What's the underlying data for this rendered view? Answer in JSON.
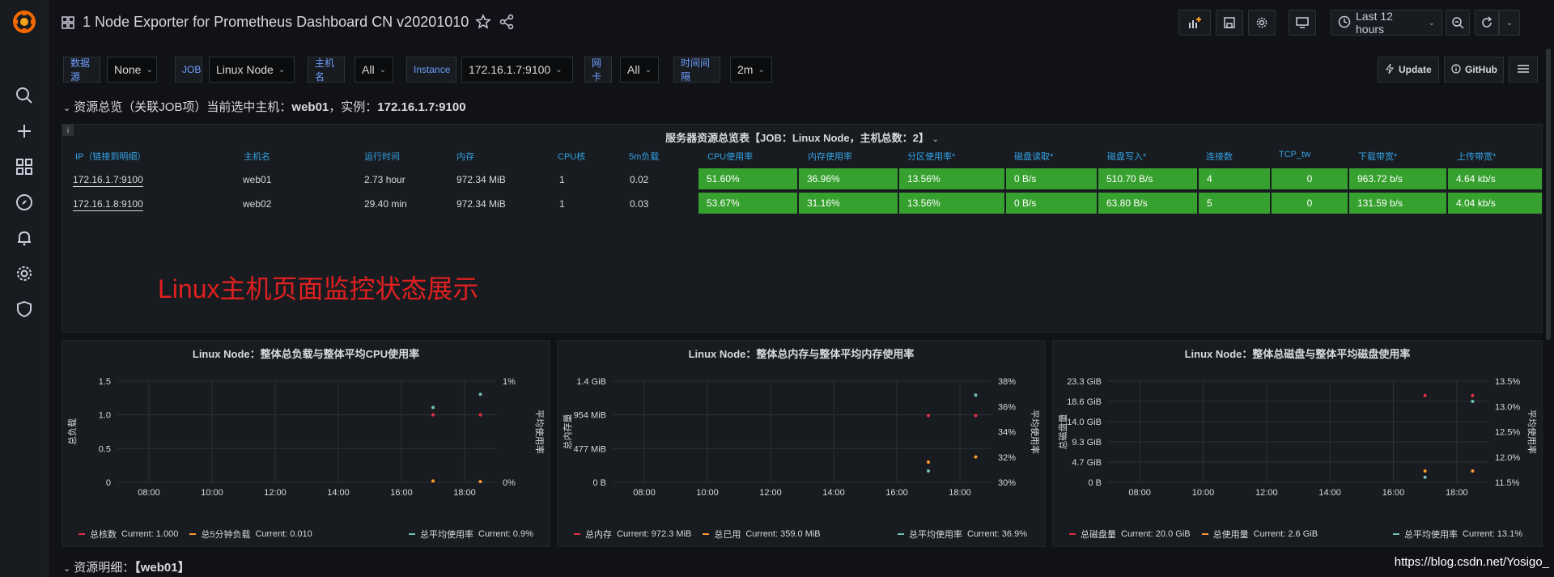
{
  "app": {
    "title": "1 Node Exporter for Prometheus Dashboard CN v20201010",
    "time_range": "Last 12 hours"
  },
  "variables": [
    {
      "label": "数据源",
      "value": "None"
    },
    {
      "label": "JOB",
      "value": "Linux Node"
    },
    {
      "label": "主机名",
      "value": "All"
    },
    {
      "label": "Instance",
      "value": "172.16.1.7:9100"
    },
    {
      "label": "网卡",
      "value": "All"
    },
    {
      "label": "时间间隔",
      "value": "2m"
    }
  ],
  "right_buttons": {
    "update": "Update",
    "github": "GitHub"
  },
  "rows": {
    "overview": {
      "prefix": "资源总览（关联JOB项）当前选中主机：",
      "host": "web01",
      "mid": "，实例：",
      "instance": "172.16.1.7:9100"
    },
    "detail": {
      "prefix": "资源明细：",
      "host": "【web01】"
    }
  },
  "table": {
    "title": "服务器资源总览表【JOB：Linux Node，主机总数：2】",
    "columns": [
      "IP（链接到明细）",
      "主机名",
      "运行时间",
      "内存",
      "CPU核",
      "5m负载",
      "CPU使用率",
      "内存使用率",
      "分区使用率*",
      "磁盘读取*",
      "磁盘写入*",
      "连接数",
      "TCP_tw",
      "下载带宽*",
      "上传带宽*"
    ],
    "rows": [
      [
        "172.16.1.7:9100",
        "web01",
        "2.73 hour",
        "972.34 MiB",
        "1",
        "0.02",
        "51.60%",
        "36.96%",
        "13.56%",
        "0 B/s",
        "510.70 B/s",
        "4",
        "0",
        "963.72 b/s",
        "4.64 kb/s"
      ],
      [
        "172.16.1.8:9100",
        "web02",
        "29.40 min",
        "972.34 MiB",
        "1",
        "0.03",
        "53.67%",
        "31.16%",
        "13.56%",
        "0 B/s",
        "63.80 B/s",
        "5",
        "0",
        "131.59 b/s",
        "4.04 kb/s"
      ]
    ],
    "annotation": "Linux主机页面监控状态展示",
    "colors": {
      "ok": "#37a12f",
      "header": "#33a2e5"
    }
  },
  "chart_data": [
    {
      "type": "scatter",
      "title": "Linux Node：整体总负载与整体平均CPU使用率",
      "x_ticks": [
        "08:00",
        "10:00",
        "12:00",
        "14:00",
        "16:00",
        "18:00"
      ],
      "y_left": {
        "label": "总负载",
        "ticks": [
          "0",
          "0.5",
          "1.0",
          "1.5"
        ],
        "range": [
          0,
          1.5
        ]
      },
      "y_right": {
        "label": "平均使用率",
        "ticks": [
          "0%",
          "1%"
        ],
        "range": [
          0,
          1
        ]
      },
      "series": [
        {
          "name": "总核数",
          "color": "#e02f44",
          "axis": "left",
          "points": [
            [
              "17:00",
              1.0
            ],
            [
              "18:30",
              1.0
            ]
          ],
          "legend": "Current: 1.000"
        },
        {
          "name": "总5分钟负载",
          "color": "#ff9830",
          "axis": "left",
          "points": [
            [
              "17:00",
              0.02
            ],
            [
              "18:30",
              0.01
            ]
          ],
          "legend": "Current: 0.010"
        },
        {
          "name": "总平均使用率",
          "color": "#73bfb8",
          "axis": "right",
          "points": [
            [
              "17:00",
              0.74
            ],
            [
              "18:30",
              0.87
            ]
          ],
          "legend": "Current: 0.9%"
        }
      ]
    },
    {
      "type": "scatter",
      "title": "Linux Node：整体总内存与整体平均内存使用率",
      "x_ticks": [
        "08:00",
        "10:00",
        "12:00",
        "14:00",
        "16:00",
        "18:00"
      ],
      "y_left": {
        "label": "总内存量",
        "ticks": [
          "0 B",
          "477 MiB",
          "954 MiB",
          "1.4 GiB"
        ],
        "range": [
          0,
          1431
        ]
      },
      "y_right": {
        "label": "平均使用率",
        "ticks": [
          "30%",
          "32%",
          "34%",
          "36%",
          "38%"
        ],
        "range": [
          30,
          38
        ]
      },
      "series": [
        {
          "name": "总内存",
          "color": "#e02f44",
          "axis": "left",
          "points": [
            [
              "17:00",
              944.7
            ],
            [
              "18:30",
              944.7
            ]
          ],
          "legend": "Current: 972.3 MiB"
        },
        {
          "name": "总已用",
          "color": "#ff9830",
          "axis": "left",
          "points": [
            [
              "17:00",
              286
            ],
            [
              "18:30",
              359
            ]
          ],
          "legend": "Current: 359.0 MiB"
        },
        {
          "name": "总平均使用率",
          "color": "#73bfb8",
          "axis": "right",
          "points": [
            [
              "17:00",
              30.9
            ],
            [
              "18:30",
              36.9
            ]
          ],
          "legend": "Current: 36.9%"
        }
      ]
    },
    {
      "type": "scatter",
      "title": "Linux Node：整体总磁盘与整体平均磁盘使用率",
      "x_ticks": [
        "08:00",
        "10:00",
        "12:00",
        "14:00",
        "16:00",
        "18:00"
      ],
      "y_left": {
        "label": "总磁盘量",
        "ticks": [
          "0 B",
          "4.7 GiB",
          "9.3 GiB",
          "14.0 GiB",
          "18.6 GiB",
          "23.3 GiB"
        ],
        "range": [
          0,
          23.3
        ]
      },
      "y_right": {
        "label": "平均使用率",
        "ticks": [
          "11.5%",
          "12.0%",
          "12.5%",
          "13.0%",
          "13.5%"
        ],
        "range": [
          11.5,
          13.5
        ]
      },
      "series": [
        {
          "name": "总磁盘量",
          "color": "#e02f44",
          "axis": "left",
          "points": [
            [
              "17:00",
              20.0
            ],
            [
              "18:30",
              20.0
            ]
          ],
          "legend": "Current: 20.0 GiB"
        },
        {
          "name": "总使用量",
          "color": "#ff9830",
          "axis": "left",
          "points": [
            [
              "17:00",
              2.6
            ],
            [
              "18:30",
              2.6
            ]
          ],
          "legend": "Current: 2.6 GiB"
        },
        {
          "name": "总平均使用率",
          "color": "#73bfb8",
          "axis": "right",
          "points": [
            [
              "17:00",
              11.6
            ],
            [
              "18:30",
              13.1
            ]
          ],
          "legend": "Current: 13.1%"
        }
      ]
    }
  ],
  "footer": {
    "url": "https://blog.csdn.net/Yosigo_"
  }
}
